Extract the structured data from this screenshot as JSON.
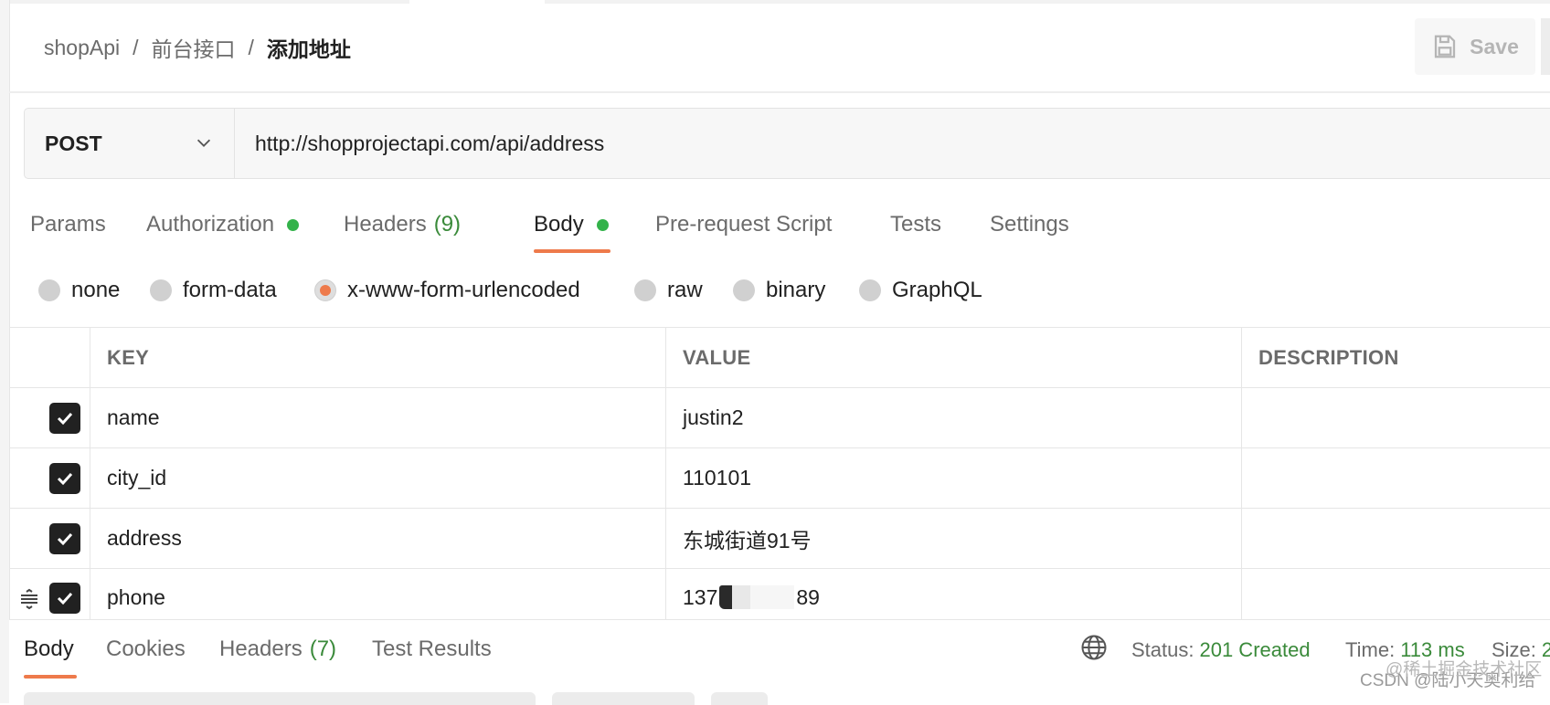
{
  "breadcrumb": {
    "collection": "shopApi",
    "folder": "前台接口",
    "request": "添加地址",
    "separator": "/"
  },
  "toolbar": {
    "save_label": "Save"
  },
  "request": {
    "method": "POST",
    "url": "http://shopprojectapi.com/api/address"
  },
  "request_tabs": {
    "params": "Params",
    "authorization": "Authorization",
    "headers": "Headers",
    "headers_count": "(9)",
    "body": "Body",
    "prerequest": "Pre-request Script",
    "tests": "Tests",
    "settings": "Settings"
  },
  "body_types": {
    "none": "none",
    "form_data": "form-data",
    "urlencoded": "x-www-form-urlencoded",
    "raw": "raw",
    "binary": "binary",
    "graphql": "GraphQL",
    "selected": "x-www-form-urlencoded"
  },
  "table": {
    "columns": {
      "key": "KEY",
      "value": "VALUE",
      "description": "DESCRIPTION"
    },
    "rows": [
      {
        "key": "name",
        "value": "justin2",
        "checked": true
      },
      {
        "key": "city_id",
        "value": "110101",
        "checked": true
      },
      {
        "key": "address",
        "value": "东城街道91号",
        "checked": true
      },
      {
        "key": "phone",
        "value_prefix": "137",
        "value_suffix": "89",
        "checked": true
      }
    ]
  },
  "response_tabs": {
    "body": "Body",
    "cookies": "Cookies",
    "headers": "Headers",
    "headers_count": "(7)",
    "test_results": "Test Results"
  },
  "response_status": {
    "status_label": "Status:",
    "status_value": "201 Created",
    "time_label": "Time:",
    "time_value": "113 ms",
    "size_label": "Size:",
    "size_value": "2"
  },
  "watermark": {
    "line1": "@稀土掘金技术社区",
    "line2": "CSDN @陆小天奥利给"
  },
  "colors": {
    "accent": "#ee7a4b",
    "success": "#33b24a",
    "count_text": "#3a8a3a"
  }
}
